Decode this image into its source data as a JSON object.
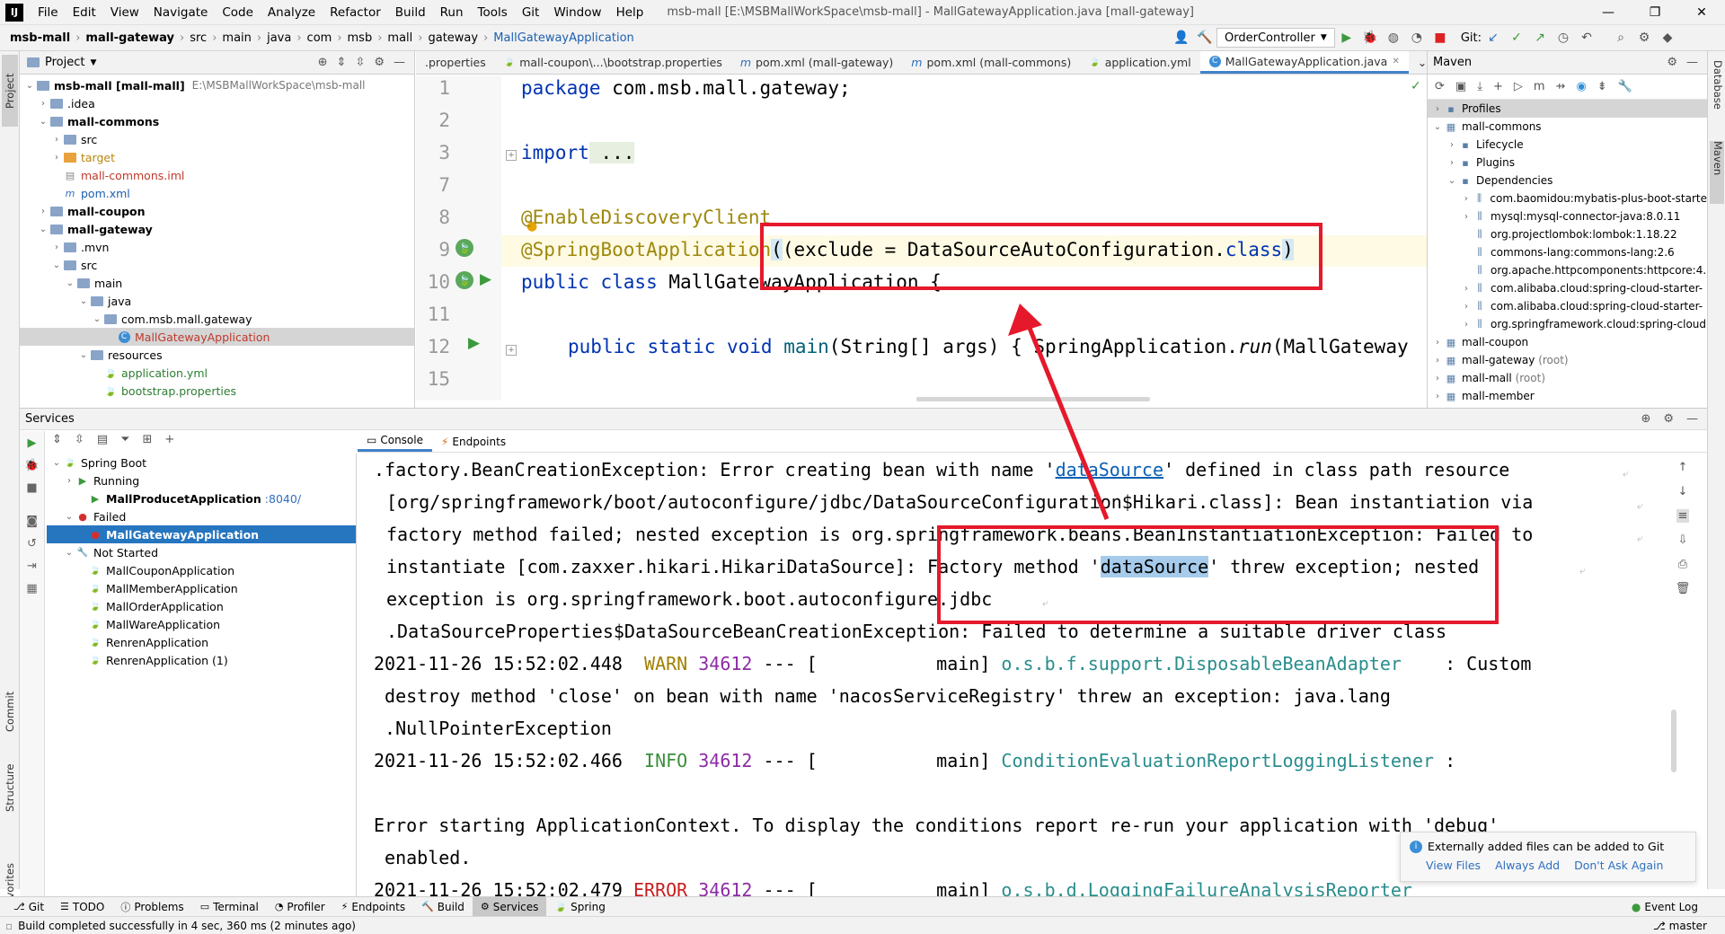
{
  "menu": {
    "items": [
      "File",
      "Edit",
      "View",
      "Navigate",
      "Code",
      "Analyze",
      "Refactor",
      "Build",
      "Run",
      "Tools",
      "Git",
      "Window",
      "Help"
    ],
    "window_title": "msb-mall [E:\\MSBMallWorkSpace\\msb-mall] - MallGatewayApplication.java [mall-gateway]"
  },
  "breadcrumbs": [
    "msb-mall",
    "mall-gateway",
    "src",
    "main",
    "java",
    "com",
    "msb",
    "mall",
    "gateway",
    "MallGatewayApplication"
  ],
  "toolbar": {
    "run_config": "OrderController",
    "git_label": "Git:"
  },
  "project": {
    "title": "Project",
    "tree": [
      {
        "label": "msb-mall [mall-mall]",
        "extra": "E:\\MSBMallWorkSpace\\msb-mall",
        "depth": 0,
        "arrow": "v",
        "icon": "folder",
        "style": "bold"
      },
      {
        "label": ".idea",
        "depth": 1,
        "arrow": ">",
        "icon": "folder",
        "style": ""
      },
      {
        "label": "mall-commons",
        "depth": 1,
        "arrow": "v",
        "icon": "folder",
        "style": "bold"
      },
      {
        "label": "src",
        "depth": 2,
        "arrow": ">",
        "icon": "folder",
        "style": ""
      },
      {
        "label": "target",
        "depth": 2,
        "arrow": ">",
        "icon": "folder-y",
        "style": ""
      },
      {
        "label": "mall-commons.iml",
        "depth": 2,
        "arrow": "",
        "icon": "file",
        "style": "red"
      },
      {
        "label": "pom.xml",
        "depth": 2,
        "arrow": "",
        "icon": "m",
        "style": ""
      },
      {
        "label": "mall-coupon",
        "depth": 1,
        "arrow": ">",
        "icon": "folder",
        "style": "bold"
      },
      {
        "label": "mall-gateway",
        "depth": 1,
        "arrow": "v",
        "icon": "folder",
        "style": "bold"
      },
      {
        "label": ".mvn",
        "depth": 2,
        "arrow": ">",
        "icon": "folder",
        "style": ""
      },
      {
        "label": "src",
        "depth": 2,
        "arrow": "v",
        "icon": "folder",
        "style": ""
      },
      {
        "label": "main",
        "depth": 3,
        "arrow": "v",
        "icon": "folder",
        "style": ""
      },
      {
        "label": "java",
        "depth": 4,
        "arrow": "v",
        "icon": "folder",
        "style": ""
      },
      {
        "label": "com.msb.mall.gateway",
        "depth": 5,
        "arrow": "v",
        "icon": "folder",
        "style": ""
      },
      {
        "label": "MallGatewayApplication",
        "depth": 6,
        "arrow": "",
        "icon": "class",
        "style": "red sel"
      },
      {
        "label": "resources",
        "depth": 4,
        "arrow": "v",
        "icon": "folder",
        "style": ""
      },
      {
        "label": "application.yml",
        "depth": 5,
        "arrow": "",
        "icon": "leaf",
        "style": "green"
      },
      {
        "label": "bootstrap.properties",
        "depth": 5,
        "arrow": "",
        "icon": "leaf",
        "style": "green"
      }
    ]
  },
  "editor_tabs": [
    {
      "label": ".properties",
      "icon": ""
    },
    {
      "label": "mall-coupon\\...\\bootstrap.properties",
      "icon": "leaf"
    },
    {
      "label": "pom.xml (mall-gateway)",
      "icon": "m"
    },
    {
      "label": "pom.xml (mall-commons)",
      "icon": "m"
    },
    {
      "label": "application.yml",
      "icon": "leaf"
    },
    {
      "label": "MallGatewayApplication.java",
      "icon": "class"
    }
  ],
  "code": {
    "line_numbers": [
      "1",
      "2",
      "3",
      "7",
      "8",
      "9",
      "10",
      "11",
      "12",
      "15"
    ],
    "l1_kw": "package",
    "l1_rest": " com.msb.mall.gateway;",
    "l3_kw": "import",
    "l3_rest": " ...",
    "l8": "@EnableDiscoveryClient",
    "l9_ann": "@SpringBootApplication",
    "l9_rest": "(exclude = DataSourceAutoConfiguration.",
    "l9_kw": "class",
    "l9_end": ")",
    "l10_kw": "public class",
    "l10_rest": " MallGatewayApplication {",
    "l12_kw": "public static void",
    "l12_fn": " main",
    "l12_args": "(String[] args) {",
    "l12_call": " SpringApplication.",
    "l12_run": "run",
    "l12_tail": "(MallGateway"
  },
  "maven": {
    "title": "Maven",
    "tree": [
      {
        "label": "Profiles",
        "depth": 0,
        "arrow": ">",
        "sel": true
      },
      {
        "label": "mall-commons",
        "depth": 0,
        "arrow": "v"
      },
      {
        "label": "Lifecycle",
        "depth": 1,
        "arrow": ">"
      },
      {
        "label": "Plugins",
        "depth": 1,
        "arrow": ">"
      },
      {
        "label": "Dependencies",
        "depth": 1,
        "arrow": "v"
      },
      {
        "label": "com.baomidou:mybatis-plus-boot-starte",
        "depth": 2,
        "arrow": ">"
      },
      {
        "label": "mysql:mysql-connector-java:8.0.11",
        "depth": 2,
        "arrow": ">"
      },
      {
        "label": "org.projectlombok:lombok:1.18.22",
        "depth": 2,
        "arrow": ""
      },
      {
        "label": "commons-lang:commons-lang:2.6",
        "depth": 2,
        "arrow": ""
      },
      {
        "label": "org.apache.httpcomponents:httpcore:4.",
        "depth": 2,
        "arrow": ""
      },
      {
        "label": "com.alibaba.cloud:spring-cloud-starter-",
        "depth": 2,
        "arrow": ">"
      },
      {
        "label": "com.alibaba.cloud:spring-cloud-starter-",
        "depth": 2,
        "arrow": ">"
      },
      {
        "label": "org.springframework.cloud:spring-cloud",
        "depth": 2,
        "arrow": ">"
      },
      {
        "label": "mall-coupon",
        "depth": 0,
        "arrow": ">"
      },
      {
        "label": "mall-gateway (root)",
        "depth": 0,
        "arrow": ">"
      },
      {
        "label": "mall-mall (root)",
        "depth": 0,
        "arrow": ">"
      },
      {
        "label": "mall-member",
        "depth": 0,
        "arrow": ">"
      }
    ]
  },
  "services": {
    "title": "Services",
    "tabs": [
      "Console",
      "Endpoints"
    ],
    "tree": [
      {
        "label": "Spring Boot",
        "depth": 0,
        "arrow": "v",
        "icon": "leaf",
        "extra": ""
      },
      {
        "label": "Running",
        "depth": 1,
        "arrow": ">",
        "icon": "run",
        "extra": ""
      },
      {
        "label": "MallProducetApplication",
        "depth": 2,
        "arrow": "",
        "icon": "run",
        "extra": ":8040/",
        "style": "bold"
      },
      {
        "label": "Failed",
        "depth": 1,
        "arrow": "v",
        "icon": "fail",
        "extra": ""
      },
      {
        "label": "MallGatewayApplication",
        "depth": 2,
        "arrow": "",
        "icon": "fail",
        "extra": "",
        "style": "sela"
      },
      {
        "label": "Not Started",
        "depth": 1,
        "arrow": "v",
        "icon": "wrench",
        "extra": ""
      },
      {
        "label": "MallCouponApplication",
        "depth": 2,
        "arrow": "",
        "icon": "leaf",
        "extra": ""
      },
      {
        "label": "MallMemberApplication",
        "depth": 2,
        "arrow": "",
        "icon": "leaf",
        "extra": ""
      },
      {
        "label": "MallOrderApplication",
        "depth": 2,
        "arrow": "",
        "icon": "leaf",
        "extra": ""
      },
      {
        "label": "MallWareApplication",
        "depth": 2,
        "arrow": "",
        "icon": "leaf",
        "extra": ""
      },
      {
        "label": "RenrenApplication",
        "depth": 2,
        "arrow": "",
        "icon": "leaf",
        "extra": ""
      },
      {
        "label": "RenrenApplication (1)",
        "depth": 2,
        "arrow": "",
        "icon": "leaf",
        "extra": ""
      }
    ]
  },
  "console": {
    "c1a": ".factory.BeanCreationException: Error creating bean with name '",
    "c1b": "dataSource",
    "c1c": "' defined in class path resource",
    "c2": "[org/springframework/boot/autoconfigure/jdbc/DataSourceConfiguration$Hikari.class]: Bean instantiation via",
    "c3": "factory method failed; nested exception is org.springframework.beans.BeanInstantiationException: Failed to",
    "c4a": "instantiate [com.zaxxer.hikari.HikariDataSource]: Factory method '",
    "c4b": "dataSource",
    "c4c": "' threw exception; nested",
    "c5": "exception is org.springframework.boot.autoconfigure.jdbc",
    "c6": ".DataSourceProperties$DataSourceBeanCreationException: Failed to determine a suitable driver class",
    "c7ts": "2021-11-26 15:52:02.448  ",
    "c7lvl": "WARN",
    "c7pid": " 34612",
    "c7mid": " --- [           main] ",
    "c7cls": "o.s.b.f.support.DisposableBeanAdapter",
    "c7tail": "    : Custom",
    "c8": " destroy method 'close' on bean with name 'nacosServiceRegistry' threw an exception: java.lang",
    "c9": " .NullPointerException",
    "c10ts": "2021-11-26 15:52:02.466  ",
    "c10lvl": "INFO",
    "c10pid": " 34612",
    "c10mid": " --- [           main] ",
    "c10cls": "ConditionEvaluationReportLoggingListener",
    "c10tail": " :",
    "c12": "Error starting ApplicationContext. To display the conditions report re-run your application with 'debug'",
    "c13": " enabled.",
    "c14ts": "2021-11-26 15:52:02.479 ",
    "c14lvl": "ERROR",
    "c14pid": " 34612",
    "c14mid": " --- [           main] ",
    "c14cls": "o.s.b.d.LoggingFailureAnalysisReporter"
  },
  "notification": {
    "text": "Externally added files can be added to Git",
    "actions": [
      "View Files",
      "Always Add",
      "Don't Ask Again"
    ]
  },
  "bottom_tabs": [
    "Git",
    "TODO",
    "Problems",
    "Terminal",
    "Profiler",
    "Endpoints",
    "Build",
    "Services",
    "Spring"
  ],
  "event_log": "Event Log",
  "status": {
    "text": "Build completed successfully in 4 sec, 360 ms (2 minutes ago)",
    "branch": "master"
  },
  "left_strip": [
    "Project",
    "Commit",
    "Structure",
    "Favorites"
  ],
  "right_strip": [
    "Database",
    "Maven"
  ]
}
